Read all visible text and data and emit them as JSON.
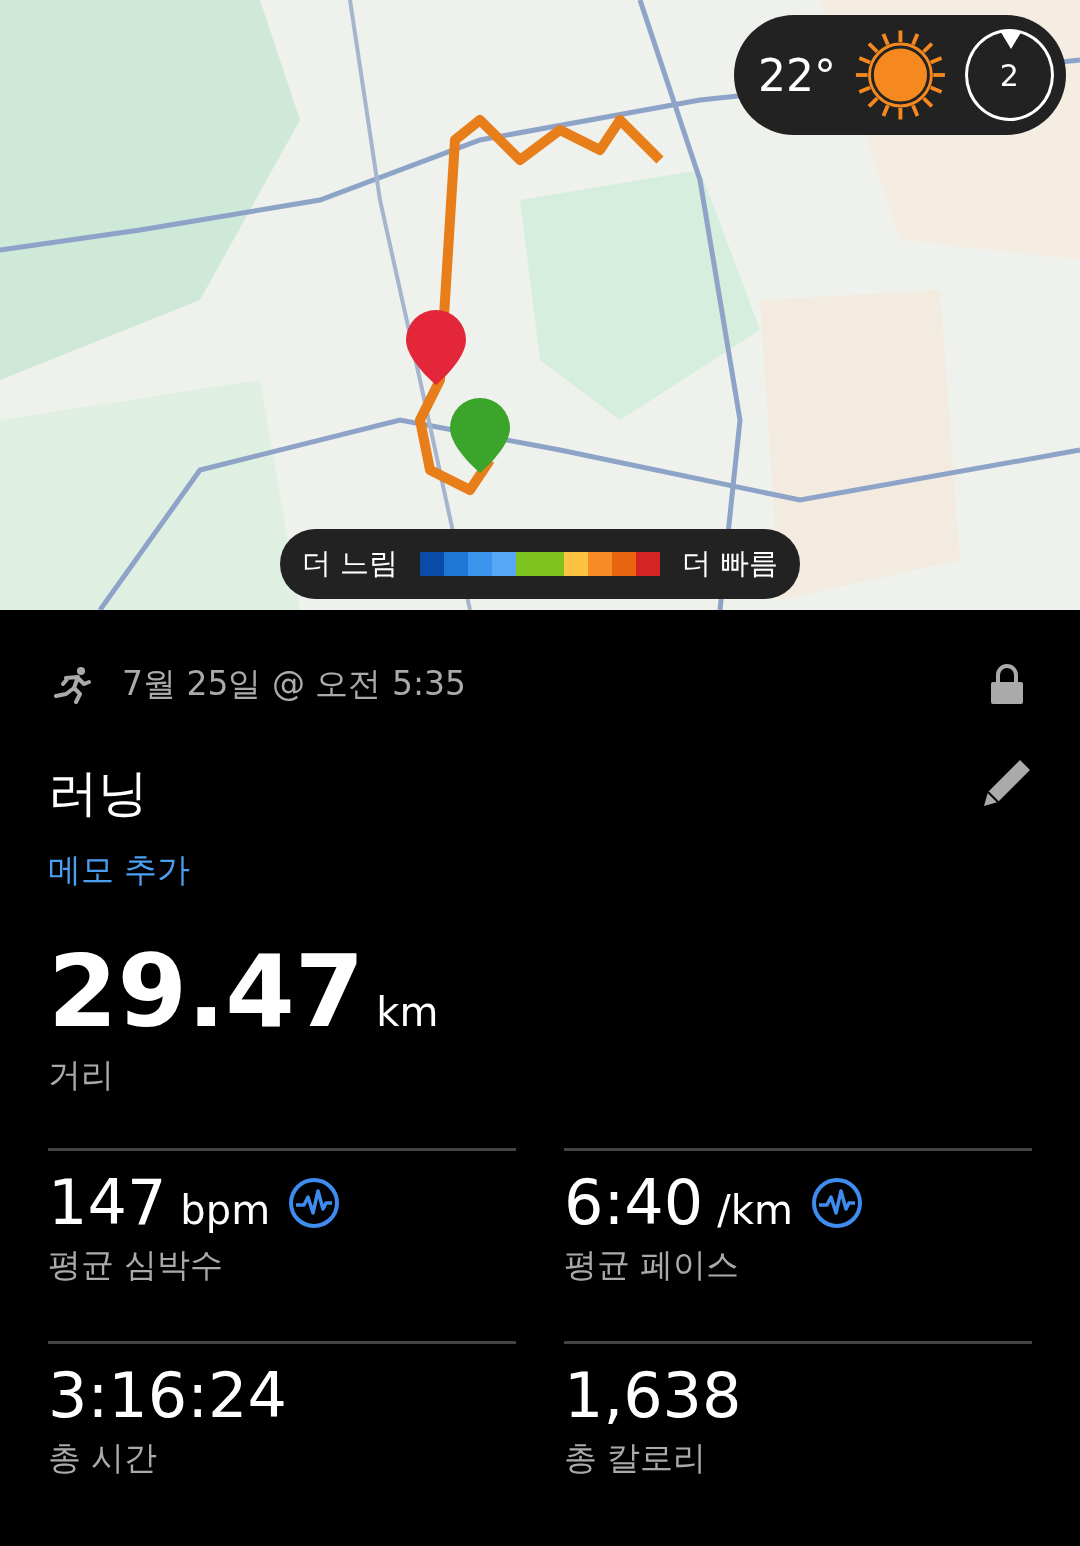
{
  "map": {
    "weather": {
      "temperature": "22°",
      "wind_level": "2"
    },
    "speed_legend": {
      "slower_label": "더 느림",
      "faster_label": "더 빠름",
      "segments": [
        {
          "color": "#0b4aa8"
        },
        {
          "color": "#1f78d6"
        },
        {
          "color": "#3b95ec"
        },
        {
          "color": "#56a8f5"
        },
        {
          "color": "#7fc31f"
        },
        {
          "color": "#7fc31f"
        },
        {
          "color": "#fbc243"
        },
        {
          "color": "#f78c24"
        },
        {
          "color": "#e8650f"
        },
        {
          "color": "#d42424"
        }
      ]
    }
  },
  "activity": {
    "datetime": "7월 25일 @ 오전 5:35",
    "locked": true,
    "title": "러닝",
    "memo_link": "메모 추가"
  },
  "distance": {
    "value": "29.47",
    "unit": "km",
    "label": "거리"
  },
  "stats": [
    {
      "value": "147",
      "unit": "bpm",
      "label": "평균 심박수",
      "has_chart": true
    },
    {
      "value": "6:40",
      "unit": "/km",
      "label": "평균 페이스",
      "has_chart": true
    },
    {
      "value": "3:16:24",
      "label": "총 시간",
      "has_chart": false
    },
    {
      "value": "1,638",
      "label": "총 칼로리",
      "has_chart": false
    }
  ]
}
